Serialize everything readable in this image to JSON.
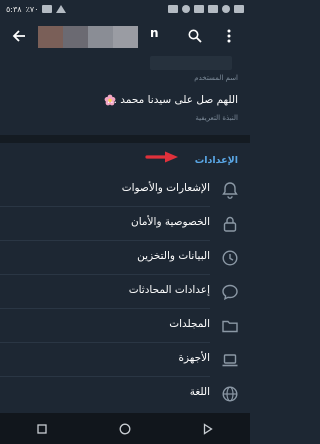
{
  "status_bar": {
    "time": "٥:٣٨",
    "battery": "٪٧٠"
  },
  "header": {
    "title": "n"
  },
  "profile": {
    "username_hint": "اسم المستخدم",
    "bio": "اللهم صل على سيدنا محمد ...",
    "bio_hint": "النبذة التعريفية"
  },
  "settings": {
    "section_title": "الإعدادات",
    "items": [
      {
        "label": "الإشعارات والأصوات",
        "icon": "bell-icon"
      },
      {
        "label": "الخصوصية والأمان",
        "icon": "lock-icon"
      },
      {
        "label": "البيانات والتخزين",
        "icon": "clock-icon"
      },
      {
        "label": "إعدادات المحادثات",
        "icon": "chat-bubble-icon"
      },
      {
        "label": "المجلدات",
        "icon": "folder-icon"
      },
      {
        "label": "الأجهزة",
        "icon": "laptop-icon"
      },
      {
        "label": "اللغة",
        "icon": "globe-icon"
      }
    ]
  },
  "colors": {
    "background": "#1d2733",
    "accent": "#5aa7e6",
    "arrow": "#e0313b"
  }
}
